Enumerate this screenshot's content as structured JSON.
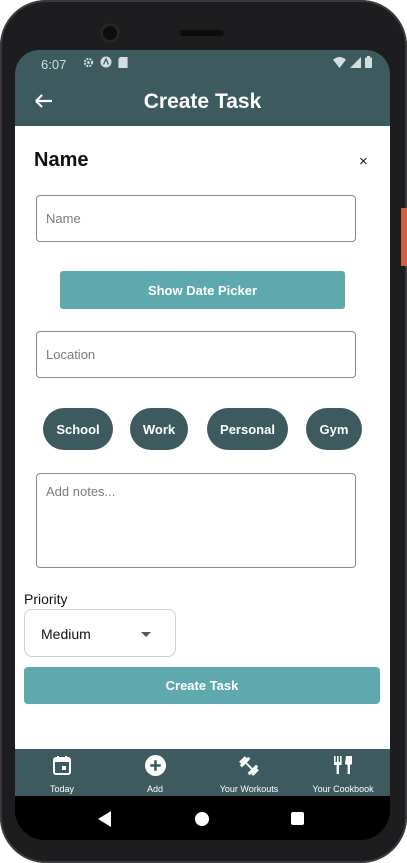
{
  "status_bar": {
    "time": "6:07"
  },
  "header": {
    "back_icon": "arrow-left-icon",
    "title": "Create Task"
  },
  "form": {
    "title": "Name",
    "close_label": "×",
    "name_placeholder": "Name",
    "date_button": "Show Date Picker",
    "location_placeholder": "Location",
    "categories": [
      "School",
      "Work",
      "Personal",
      "Gym"
    ],
    "notes_placeholder": "Add notes...",
    "priority_label": "Priority",
    "priority_value": "Medium",
    "submit_label": "Create Task"
  },
  "bottom_nav": {
    "items": [
      {
        "label": "Today",
        "icon": "calendar-icon"
      },
      {
        "label": "Add",
        "icon": "add-circle-icon"
      },
      {
        "label": "Your Workouts",
        "icon": "dumbbell-icon"
      },
      {
        "label": "Your Cookbook",
        "icon": "utensils-icon"
      }
    ]
  },
  "colors": {
    "header": "#3d5b5e",
    "accent_button": "#5ea9ae",
    "chip": "#3d5b5e"
  }
}
